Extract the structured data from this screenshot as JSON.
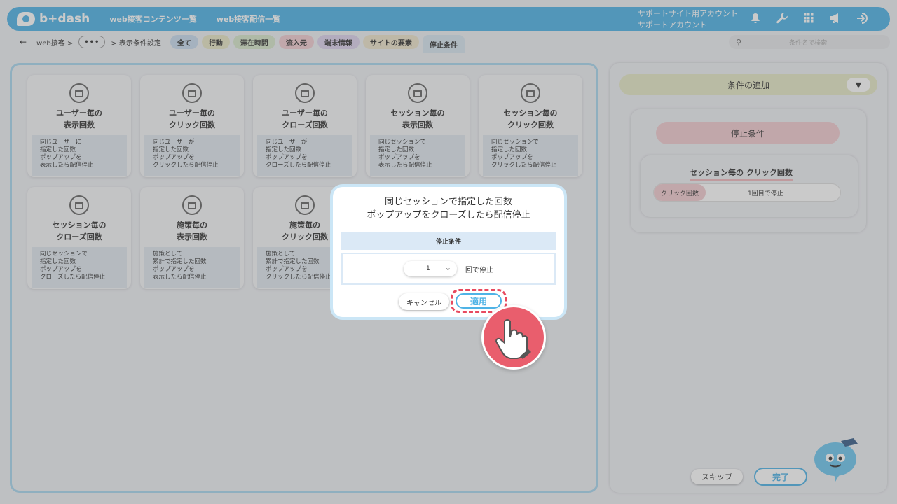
{
  "header": {
    "logo": "b+dash",
    "nav": [
      "web接客コンテンツ一覧",
      "web接客配信一覧"
    ],
    "account_line1": "サポートサイト用アカウント",
    "account_line2": "サポートアカウント",
    "icons": [
      "bell-icon",
      "wrench-icon",
      "grid-icon",
      "megaphone-icon",
      "logout-icon"
    ]
  },
  "subbar": {
    "back": "←",
    "crumb1": "web接客 >",
    "dots": "•••",
    "crumb2": "> 表示条件設定",
    "tabs": [
      {
        "label": "全て",
        "color": "#c9dcef"
      },
      {
        "label": "行動",
        "color": "#e8e6c6"
      },
      {
        "label": "滞在時間",
        "color": "#d7e7cc"
      },
      {
        "label": "流入元",
        "color": "#f2cdd2"
      },
      {
        "label": "端末情報",
        "color": "#ddd3ee"
      },
      {
        "label": "サイトの要素",
        "color": "#eee5cc"
      },
      {
        "label": "停止条件",
        "color": "#d7e6f1"
      }
    ],
    "search_placeholder": "条件名で検索"
  },
  "cards": [
    {
      "title1": "ユーザー毎の",
      "title2": "表示回数",
      "desc": [
        "同じユーザーに",
        "指定した回数",
        "ポップアップを",
        "表示したら配信停止"
      ]
    },
    {
      "title1": "ユーザー毎の",
      "title2": "クリック回数",
      "desc": [
        "同じユーザーが",
        "指定した回数",
        "ポップアップを",
        "クリックしたら配信停止"
      ]
    },
    {
      "title1": "ユーザー毎の",
      "title2": "クローズ回数",
      "desc": [
        "同じユーザーが",
        "指定した回数",
        "ポップアップを",
        "クローズしたら配信停止"
      ]
    },
    {
      "title1": "セッション毎の",
      "title2": "表示回数",
      "desc": [
        "同じセッションで",
        "指定した回数",
        "ポップアップを",
        "表示したら配信停止"
      ]
    },
    {
      "title1": "セッション毎の",
      "title2": "クリック回数",
      "desc": [
        "同じセッションで",
        "指定した回数",
        "ポップアップを",
        "クリックしたら配信停止"
      ]
    },
    {
      "title1": "セッション毎の",
      "title2": "クローズ回数",
      "desc": [
        "同じセッションで",
        "指定した回数",
        "ポップアップを",
        "クローズしたら配信停止"
      ]
    },
    {
      "title1": "施策毎の",
      "title2": "表示回数",
      "desc": [
        "施策として",
        "累計で指定した回数",
        "ポップアップを",
        "表示したら配信停止"
      ]
    },
    {
      "title1": "施策毎の",
      "title2": "クリック回数",
      "desc": [
        "施策として",
        "累計で指定した回数",
        "ポップアップを",
        "クリックしたら配信停止"
      ]
    }
  ],
  "right": {
    "add_condition": "条件の追加",
    "stop_condition": "停止条件",
    "rule_title": "セッション毎の クリック回数",
    "rule_label": "クリック回数",
    "rule_value": "1回目で停止",
    "skip": "スキップ",
    "done": "完了"
  },
  "modal": {
    "title_line1": "同じセッションで指定した回数",
    "title_line2": "ポップアップをクローズしたら配信停止",
    "section": "停止条件",
    "select_value": "1",
    "suffix": "回で停止",
    "cancel": "キャンセル",
    "apply": "適用"
  }
}
